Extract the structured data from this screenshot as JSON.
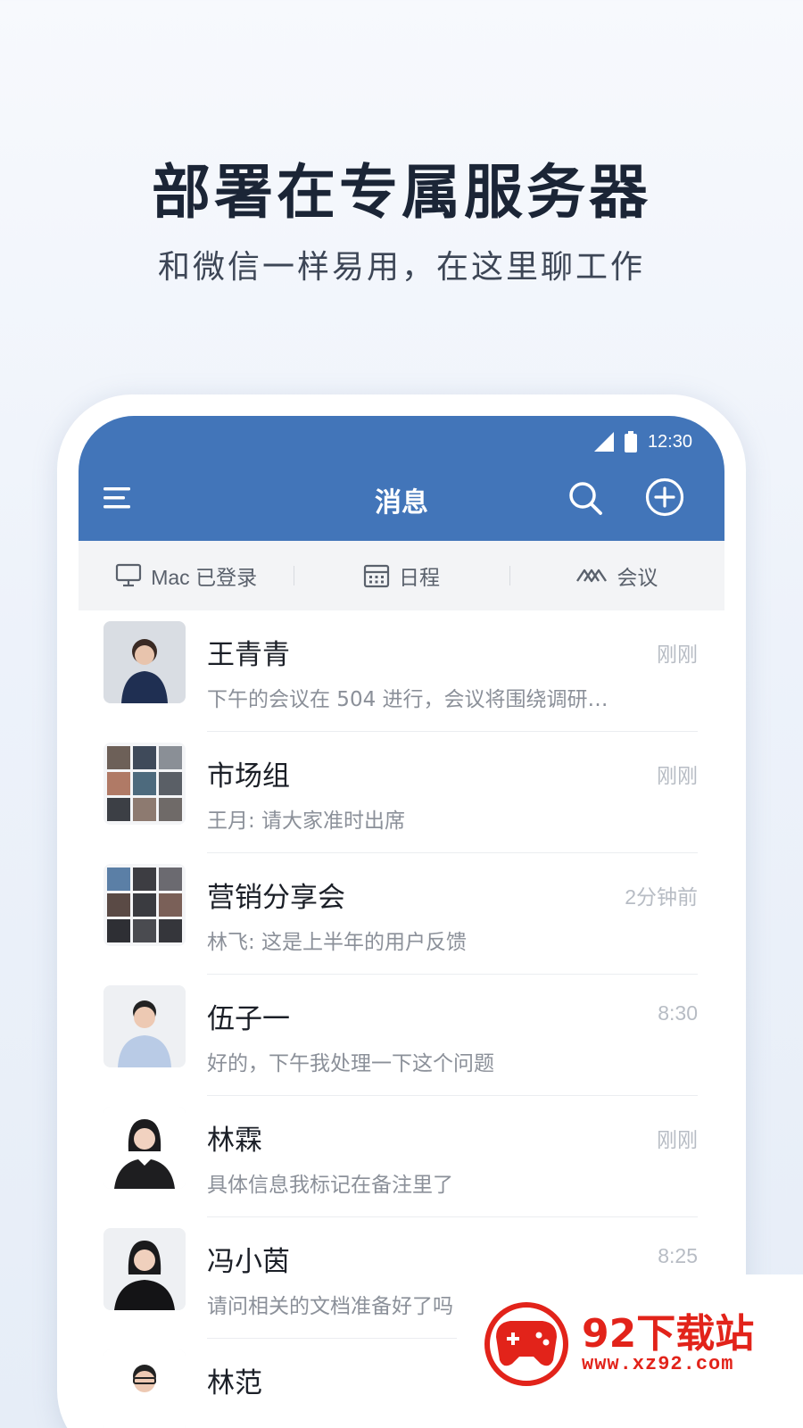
{
  "promo": {
    "title": "部署在专属服务器",
    "subtitle": "和微信一样易用，在这里聊工作"
  },
  "status_bar": {
    "time": "12:30",
    "icons": [
      "signal-icon",
      "battery-icon"
    ]
  },
  "app_bar": {
    "title": "消息",
    "icons": [
      "menu-icon",
      "search-icon",
      "add-circle-icon"
    ],
    "color": "#4275b9"
  },
  "quick_bar": {
    "items": [
      {
        "icon": "desktop-icon",
        "label": "Mac 已登录"
      },
      {
        "icon": "calendar-icon",
        "label": "日程"
      },
      {
        "icon": "meeting-icon",
        "label": "会议"
      }
    ]
  },
  "chats": [
    {
      "name": "王青青",
      "time": "刚刚",
      "preview": "下午的会议在 504 进行，会议将围绕调研…",
      "avatar": "person-avatar"
    },
    {
      "name": "市场组",
      "time": "刚刚",
      "preview": "王月: 请大家准时出席",
      "avatar": "group-avatar"
    },
    {
      "name": "营销分享会",
      "time": "2分钟前",
      "preview": "林飞: 这是上半年的用户反馈",
      "avatar": "group-avatar"
    },
    {
      "name": "伍子一",
      "time": "8:30",
      "preview": "好的，下午我处理一下这个问题",
      "avatar": "person-avatar"
    },
    {
      "name": "林霖",
      "time": "刚刚",
      "preview": "具体信息我标记在备注里了",
      "avatar": "person-avatar"
    },
    {
      "name": "冯小茵",
      "time": "8:25",
      "preview": "请问相关的文档准备好了吗",
      "avatar": "person-avatar"
    },
    {
      "name": "林范",
      "time": "",
      "preview": "",
      "avatar": "person-avatar"
    }
  ],
  "watermark": {
    "name": "92下载站",
    "url": "www.xz92.com",
    "color": "#e2231a"
  }
}
